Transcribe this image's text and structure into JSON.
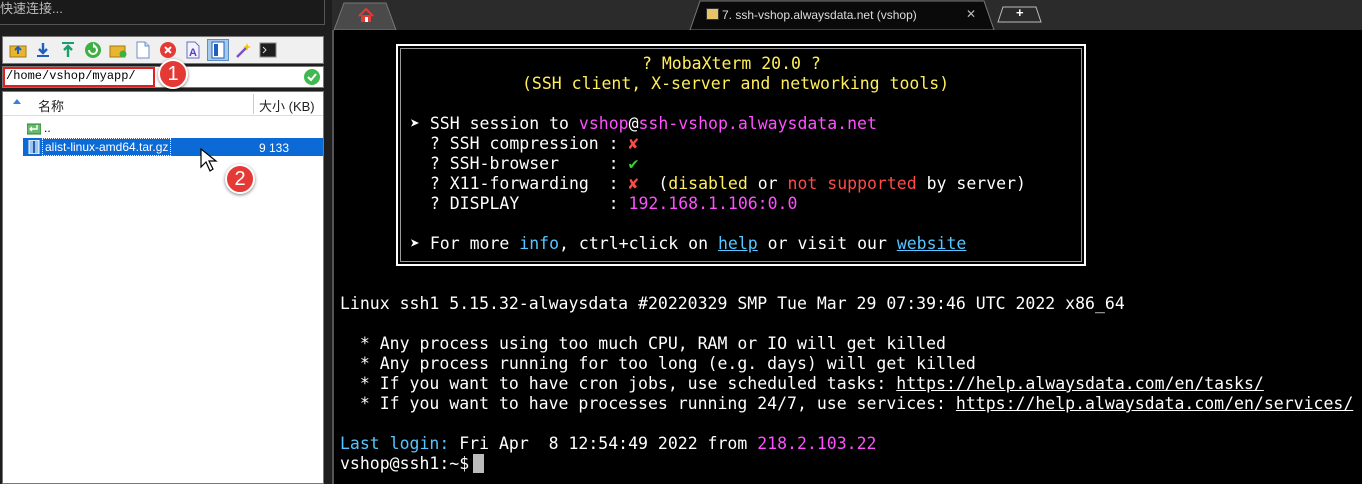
{
  "quick_connect": {
    "placeholder": "快速连接..."
  },
  "sftp": {
    "path": "/home/vshop/myapp/",
    "columns": {
      "name": "名称",
      "size": "大小 (KB)"
    },
    "rows": [
      {
        "name": "..",
        "size": "",
        "type": "parent-folder"
      },
      {
        "name": "alist-linux-amd64.tar.gz",
        "size": "9 133",
        "type": "archive"
      }
    ],
    "toolbar_icons": [
      "go-up-folder-icon",
      "download-icon",
      "upload-icon",
      "refresh-icon",
      "new-folder-icon",
      "new-file-icon",
      "delete-icon",
      "rename-icon",
      "open-in-editor-icon",
      "magic-wand-icon",
      "terminal-icon"
    ]
  },
  "annotations": {
    "badge1": "1",
    "badge2": "2"
  },
  "tabs": {
    "home_icon": "home-icon",
    "ssh_tab": "7. ssh-vshop.alwaysdata.net (vshop)",
    "close": "✕",
    "new_tab": "+"
  },
  "terminal": {
    "banner": {
      "title": "? MobaXterm 20.0 ?",
      "subtitle": "(SSH client, X-server and networking tools)",
      "session_prefix": "➤ SSH session to ",
      "user": "vshop",
      "at": "@",
      "host": "ssh-vshop.alwaysdata.net",
      "compression_label": "  ? SSH compression : ",
      "compression_val": "✘",
      "browser_label": "  ? SSH-browser     : ",
      "browser_val": "✔",
      "x11_label": "  ? X11-forwarding  : ",
      "x11_val": "✘",
      "x11_paren_open": "  (",
      "x11_disabled": "disabled",
      "x11_or": " or ",
      "x11_not_supported": "not supported",
      "x11_by": " by server)",
      "display_label": "  ? DISPLAY         : ",
      "display_val": "192.168.1.106:0.0",
      "more_prefix": "➤ For more ",
      "more_info": "info",
      "more_mid": ", ctrl+click on ",
      "more_help": "help",
      "more_mid2": " or visit our ",
      "more_website": "website"
    },
    "uname": "Linux ssh1 5.15.32-alwaysdata #20220329 SMP Tue Mar 29 07:39:46 UTC 2022 x86_64",
    "notice1": "  * Any process using too much CPU, RAM or IO will get killed",
    "notice2": "  * Any process running for too long (e.g. days) will get killed",
    "notice3_text": "  * If you want to have cron jobs, use scheduled tasks: ",
    "notice3_link": "https://help.alwaysdata.com/en/tasks/",
    "notice4_text": "  * If you want to have processes running 24/7, use services: ",
    "notice4_link": "https://help.alwaysdata.com/en/services/",
    "last_login_label": "Last login:",
    "last_login_time": " Fri Apr  8 12:54:49 2022 from ",
    "last_login_ip": "218.2.103.22",
    "prompt": "vshop@ssh1:~$"
  }
}
